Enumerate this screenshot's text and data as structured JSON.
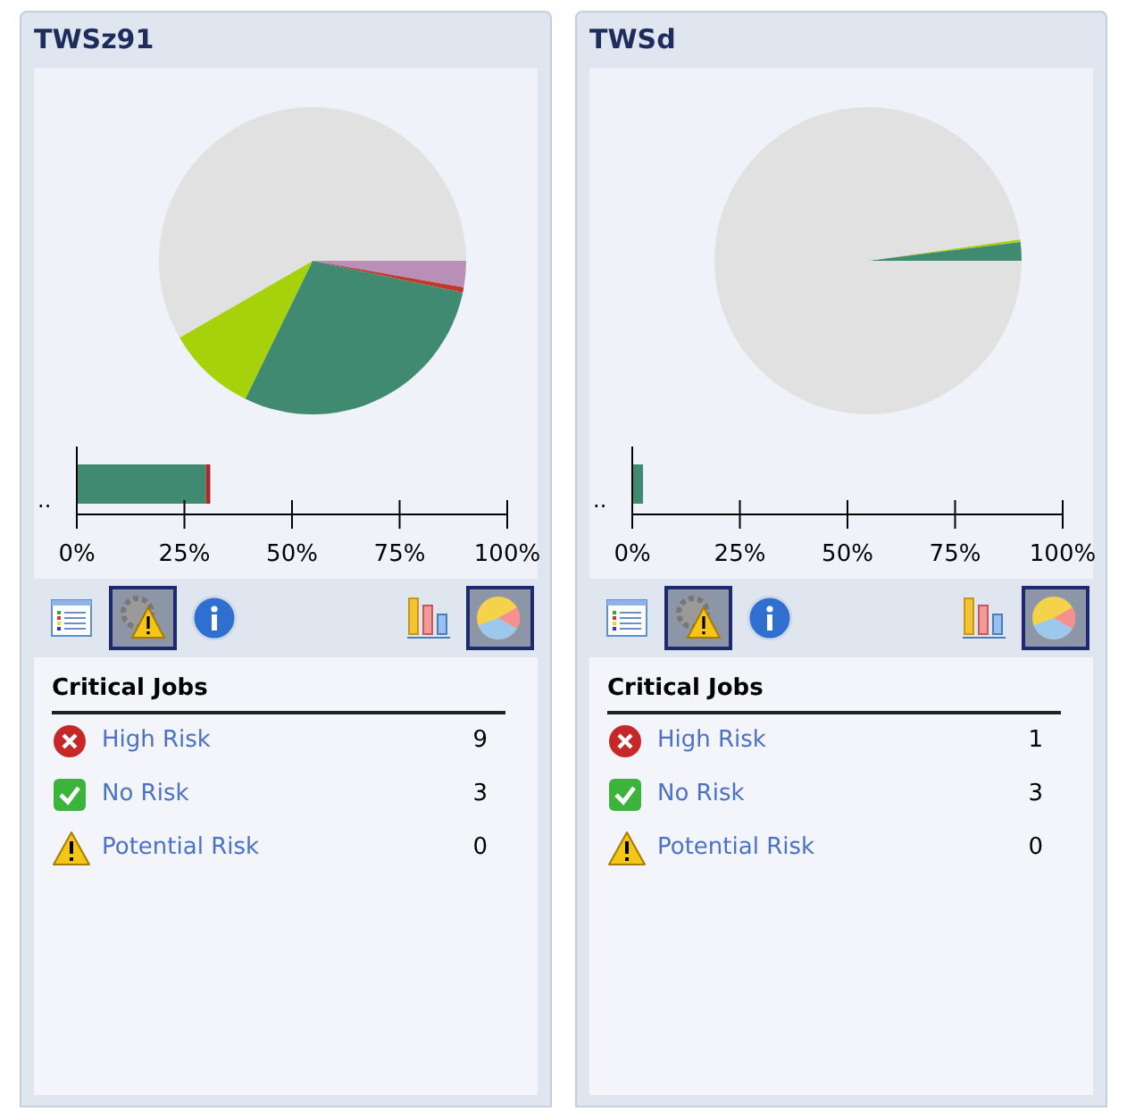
{
  "panels": [
    {
      "title": "TWSz91",
      "toolbar": [
        {
          "kind": "list",
          "selected": false
        },
        {
          "kind": "alert",
          "selected": true
        },
        {
          "kind": "info",
          "selected": false
        },
        {
          "kind": "bars",
          "selected": false
        },
        {
          "kind": "pie",
          "selected": true
        }
      ],
      "chart_data": {
        "type": "bar",
        "orientation": "horizontal",
        "stacked": true,
        "categories": [
          ".."
        ],
        "series": [
          {
            "color": "#3f8a71",
            "values": [
              30
            ]
          },
          {
            "color": "#a52a2a",
            "values": [
              1
            ]
          }
        ],
        "xlim": [
          0,
          100
        ],
        "xticks": [
          {
            "value": 0,
            "label": "0%"
          },
          {
            "value": 25,
            "label": "25%"
          },
          {
            "value": 50,
            "label": "50%"
          },
          {
            "value": 75,
            "label": "75%"
          },
          {
            "value": 100,
            "label": "100%"
          }
        ]
      },
      "jobs": {
        "title": "Critical Jobs",
        "items": [
          {
            "kind": "high",
            "label": "High Risk",
            "count": "9"
          },
          {
            "kind": "none",
            "label": "No Risk",
            "count": "3"
          },
          {
            "kind": "potential",
            "label": "Potential Risk",
            "count": "0"
          }
        ]
      }
    },
    {
      "title": "TWSd",
      "toolbar": [
        {
          "kind": "list",
          "selected": false
        },
        {
          "kind": "alert",
          "selected": true
        },
        {
          "kind": "info",
          "selected": false
        },
        {
          "kind": "bars",
          "selected": false
        },
        {
          "kind": "pie",
          "selected": true
        }
      ],
      "chart_data": {
        "type": "bar",
        "orientation": "horizontal",
        "stacked": true,
        "categories": [
          ".."
        ],
        "series": [
          {
            "color": "#3f8a71",
            "values": [
              2.5
            ]
          }
        ],
        "xlim": [
          0,
          100
        ],
        "xticks": [
          {
            "value": 0,
            "label": "0%"
          },
          {
            "value": 25,
            "label": "25%"
          },
          {
            "value": 50,
            "label": "50%"
          },
          {
            "value": 75,
            "label": "75%"
          },
          {
            "value": 100,
            "label": "100%"
          }
        ]
      },
      "jobs": {
        "title": "Critical Jobs",
        "items": [
          {
            "kind": "high",
            "label": "High Risk",
            "count": "1"
          },
          {
            "kind": "none",
            "label": "No Risk",
            "count": "3"
          },
          {
            "kind": "potential",
            "label": "Potential Risk",
            "count": "0"
          }
        ]
      }
    }
  ]
}
